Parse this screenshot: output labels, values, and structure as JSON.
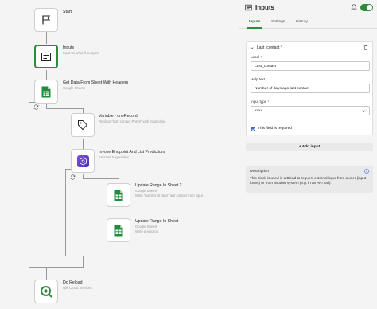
{
  "flow": {
    "nodes": [
      {
        "title": "Start",
        "sub": ""
      },
      {
        "title": "Inputs",
        "sub": "Input for what-if analysis"
      },
      {
        "title": "Get Data From Sheet With Headers",
        "sub": "Google Sheets"
      },
      {
        "title": "Variable - oneRecord",
        "sub": "Replace \"last_contact Phsys\" with input value"
      },
      {
        "title": "Invoke Endpoint And List Predictions",
        "sub": "Amazon Sagemaker"
      },
      {
        "title": "Update Range In Sheet 2",
        "sub": "Google Sheets",
        "sub2": "Write \"number of days\" last contact from input"
      },
      {
        "title": "Update Range In Sheet",
        "sub": "Google Sheets",
        "sub2": "Write prediction"
      },
      {
        "title": "Do Reload",
        "sub": "Qlik Cloud Services"
      }
    ]
  },
  "panel": {
    "title": "Inputs",
    "tabs": [
      "Inputs",
      "Settings",
      "History"
    ],
    "active_tab": "Inputs",
    "card": {
      "name": "Last_contact",
      "required_mark": "*",
      "label_caption": "Label",
      "label_value": "Last_contact",
      "help_caption": "Help text",
      "help_value": "Number of days ago last contact",
      "type_caption": "Input type",
      "type_value": "input",
      "required_caption": "This field is required"
    },
    "add_input_label": "+ Add input",
    "description": {
      "title": "Description",
      "text": "This block is used in a Blend to request external input from a user (input forms) or from another system (e.g. in an API call)."
    }
  },
  "colors": {
    "accent": "#2e8b3c",
    "checkbox": "#3b6fd6",
    "required": "#d04040"
  }
}
